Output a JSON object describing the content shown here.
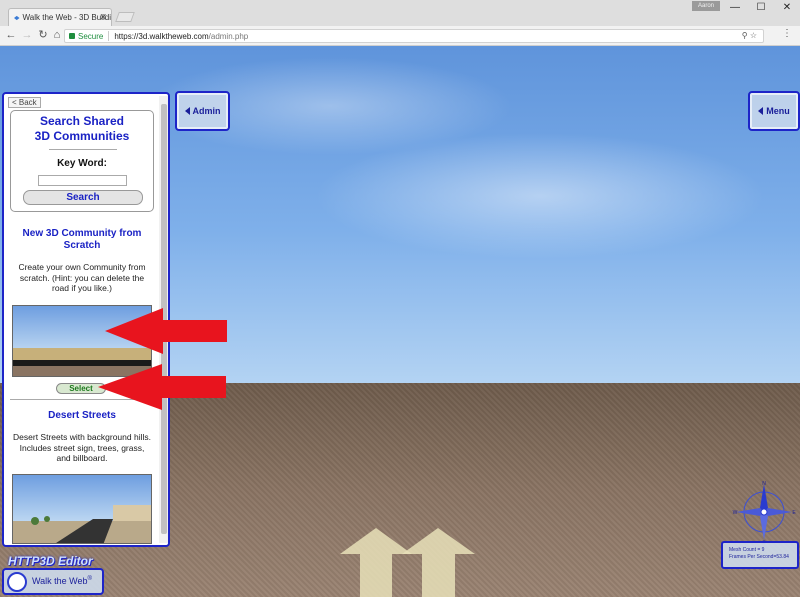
{
  "browser": {
    "tab_title": "Walk the Web - 3D Buildi",
    "user_badge": "Aaron",
    "window_controls": {
      "minimize": "—",
      "maximize": "☐",
      "close": "✕"
    },
    "address": {
      "secure_label": "Secure",
      "url_host": "https://3d.walktheweb.com",
      "url_path": "/admin.php"
    }
  },
  "overlay": {
    "admin_label": "Admin",
    "menu_label": "Menu"
  },
  "panel": {
    "back_label": "< Back",
    "search_title_line1": "Search Shared",
    "search_title_line2": "3D Communities",
    "keyword_label": "Key Word:",
    "keyword_value": "",
    "search_button": "Search",
    "communities": [
      {
        "title_line1": "New 3D Community from",
        "title_line2": "Scratch",
        "description_line1": "Create your own Community from",
        "description_line2": "scratch. (Hint: you can delete the",
        "description_line3": "road if you like.)",
        "select_label": "Select"
      },
      {
        "title_line1": "Desert Streets",
        "description_line1": "Desert Streets with background hills.",
        "description_line2": "Includes street sign, trees, grass,",
        "description_line3": "and billboard."
      }
    ]
  },
  "branding": {
    "editor_label": "HTTP3D Editor",
    "walk_button": "Walk the Web",
    "walk_button_mark": "®"
  },
  "stats": {
    "mesh_count": "Mesh Count = 9",
    "fps": "Frames Per Second=53.84"
  },
  "compass": {
    "north": "N",
    "south": "S",
    "east": "E",
    "west": "W"
  },
  "colors": {
    "accent_blue": "#1d24c8",
    "title_blue": "#1a22c4",
    "annotation_red": "#e8141e",
    "select_green": "#1e7a1e"
  }
}
